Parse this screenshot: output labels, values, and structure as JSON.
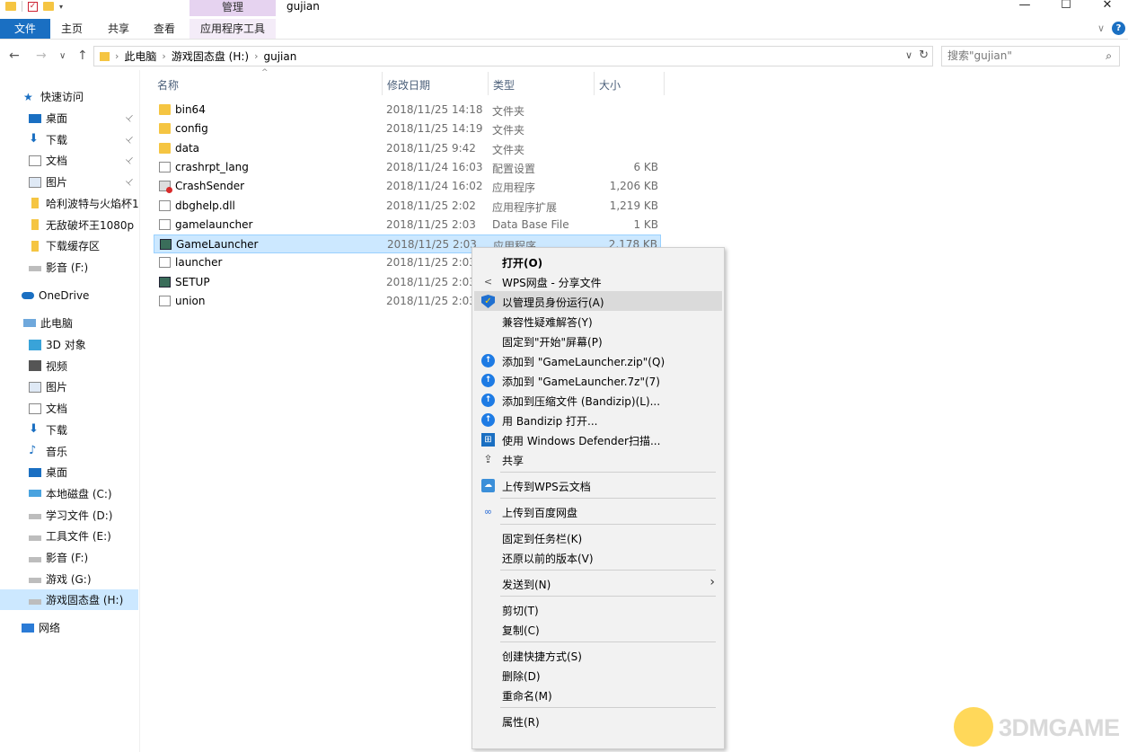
{
  "window": {
    "title": "gujian",
    "context_tab_header": "管理",
    "controls": {
      "minimize": "—",
      "maximize": "☐",
      "close": "✕"
    }
  },
  "ribbon": {
    "tabs": [
      "文件",
      "主页",
      "共享",
      "查看",
      "应用程序工具"
    ],
    "expand_glyph": "∨",
    "help_glyph": "?"
  },
  "nav": {
    "back": "←",
    "forward": "→",
    "recent": "∨",
    "up": "↑",
    "breadcrumb": [
      "此电脑",
      "游戏固态盘 (H:)",
      "gujian"
    ],
    "dropdown": "∨",
    "refresh": "↻",
    "search_placeholder": "搜索\"gujian\"",
    "search_glyph": "⌕"
  },
  "sidebar": {
    "quick_access": "快速访问",
    "quick_items": [
      {
        "label": "桌面",
        "icon": "desktop-icon",
        "pinned": true
      },
      {
        "label": "下载",
        "icon": "download-icon",
        "pinned": true
      },
      {
        "label": "文档",
        "icon": "document-icon",
        "pinned": true
      },
      {
        "label": "图片",
        "icon": "picture-icon",
        "pinned": true
      },
      {
        "label": "哈利波特与火焰杯1",
        "icon": "folder-icon",
        "pinned": false
      },
      {
        "label": "无敌破坏王1080p",
        "icon": "folder-icon",
        "pinned": false
      },
      {
        "label": "下载缓存区",
        "icon": "folder-icon",
        "pinned": false
      },
      {
        "label": "影音 (F:)",
        "icon": "drive-icon",
        "pinned": false
      }
    ],
    "onedrive": "OneDrive",
    "this_pc": "此电脑",
    "pc_items": [
      {
        "label": "3D 对象",
        "icon": "3d-objects-icon"
      },
      {
        "label": "视频",
        "icon": "video-icon"
      },
      {
        "label": "图片",
        "icon": "picture-icon"
      },
      {
        "label": "文档",
        "icon": "document-icon"
      },
      {
        "label": "下载",
        "icon": "download-icon"
      },
      {
        "label": "音乐",
        "icon": "music-icon"
      },
      {
        "label": "桌面",
        "icon": "desktop-icon"
      },
      {
        "label": "本地磁盘 (C:)",
        "icon": "system-drive-icon"
      },
      {
        "label": "学习文件 (D:)",
        "icon": "drive-icon"
      },
      {
        "label": "工具文件 (E:)",
        "icon": "drive-icon"
      },
      {
        "label": "影音 (F:)",
        "icon": "drive-icon"
      },
      {
        "label": "游戏 (G:)",
        "icon": "drive-icon"
      },
      {
        "label": "游戏固态盘 (H:)",
        "icon": "drive-icon"
      }
    ],
    "network": "网络",
    "pin_glyph": "📌"
  },
  "columns": {
    "name": "名称",
    "date": "修改日期",
    "type": "类型",
    "size": "大小",
    "sort_glyph": "^"
  },
  "files": [
    {
      "name": "bin64",
      "date": "2018/11/25 14:18",
      "type": "文件夹",
      "size": "",
      "icon": "folder-icon"
    },
    {
      "name": "config",
      "date": "2018/11/25 14:19",
      "type": "文件夹",
      "size": "",
      "icon": "folder-icon"
    },
    {
      "name": "data",
      "date": "2018/11/25 9:42",
      "type": "文件夹",
      "size": "",
      "icon": "folder-icon"
    },
    {
      "name": "crashrpt_lang",
      "date": "2018/11/24 16:03",
      "type": "配置设置",
      "size": "6 KB",
      "icon": "config-file-icon"
    },
    {
      "name": "CrashSender",
      "date": "2018/11/24 16:02",
      "type": "应用程序",
      "size": "1,206 KB",
      "icon": "crash-sender-icon"
    },
    {
      "name": "dbghelp.dll",
      "date": "2018/11/25 2:02",
      "type": "应用程序扩展",
      "size": "1,219 KB",
      "icon": "dll-file-icon"
    },
    {
      "name": "gamelauncher",
      "date": "2018/11/25 2:03",
      "type": "Data Base File",
      "size": "1 KB",
      "icon": "db-file-icon"
    },
    {
      "name": "GameLauncher",
      "date": "2018/11/25 2:03",
      "type": "应用程序",
      "size": "2,178 KB",
      "icon": "game-launcher-icon"
    },
    {
      "name": "launcher",
      "date": "2018/11/25 2:03",
      "type": "",
      "size": "",
      "icon": "config-file-icon"
    },
    {
      "name": "SETUP",
      "date": "2018/11/25 2:03",
      "type": "",
      "size": "",
      "icon": "setup-exe-icon"
    },
    {
      "name": "union",
      "date": "2018/11/25 2:03",
      "type": "",
      "size": "",
      "icon": "file-icon"
    }
  ],
  "context_menu": {
    "items": [
      {
        "label": "打开(O)",
        "icon": "",
        "bold": true
      },
      {
        "label": "WPS网盘 - 分享文件",
        "icon": "share-nodes-icon",
        "icon_glyph": "<"
      },
      {
        "label": "以管理员身份运行(A)",
        "icon": "uac-shield-icon",
        "icon_glyph": "✓",
        "hover": true
      },
      {
        "label": "兼容性疑难解答(Y)",
        "icon": ""
      },
      {
        "label": "固定到\"开始\"屏幕(P)",
        "icon": ""
      },
      {
        "label": "添加到 \"GameLauncher.zip\"(Q)",
        "icon": "bandizip-icon",
        "icon_glyph": "↑"
      },
      {
        "label": "添加到 \"GameLauncher.7z\"(7)",
        "icon": "bandizip-icon",
        "icon_glyph": "↑"
      },
      {
        "label": "添加到压缩文件 (Bandizip)(L)...",
        "icon": "bandizip-icon",
        "icon_glyph": "↑"
      },
      {
        "label": "用 Bandizip 打开...",
        "icon": "bandizip-icon",
        "icon_glyph": "↑"
      },
      {
        "label": "使用 Windows Defender扫描...",
        "icon": "defender-icon",
        "icon_glyph": "⊞"
      },
      {
        "label": "共享",
        "icon": "share-icon",
        "icon_glyph": "⇪"
      },
      {
        "separator": true
      },
      {
        "label": "上传到WPS云文档",
        "icon": "wps-cloud-icon",
        "icon_glyph": "☁"
      },
      {
        "separator": true
      },
      {
        "label": "上传到百度网盘",
        "icon": "baidu-netdisk-icon",
        "icon_glyph": "∞"
      },
      {
        "separator": true
      },
      {
        "label": "固定到任务栏(K)",
        "icon": ""
      },
      {
        "label": "还原以前的版本(V)",
        "icon": ""
      },
      {
        "separator": true
      },
      {
        "label": "发送到(N)",
        "icon": "",
        "submenu": true
      },
      {
        "separator": true
      },
      {
        "label": "剪切(T)",
        "icon": ""
      },
      {
        "label": "复制(C)",
        "icon": ""
      },
      {
        "separator": true
      },
      {
        "label": "创建快捷方式(S)",
        "icon": ""
      },
      {
        "label": "删除(D)",
        "icon": ""
      },
      {
        "label": "重命名(M)",
        "icon": ""
      },
      {
        "separator": true
      },
      {
        "label": "属性(R)",
        "icon": ""
      }
    ],
    "submenu_glyph": "›"
  },
  "watermark": {
    "text": "3DMGAME"
  },
  "colors": {
    "accent": "#1a6fc2",
    "selection": "#cce8ff",
    "context_tab": "#e6d3f0",
    "menu_bg": "#f2f2f2"
  }
}
